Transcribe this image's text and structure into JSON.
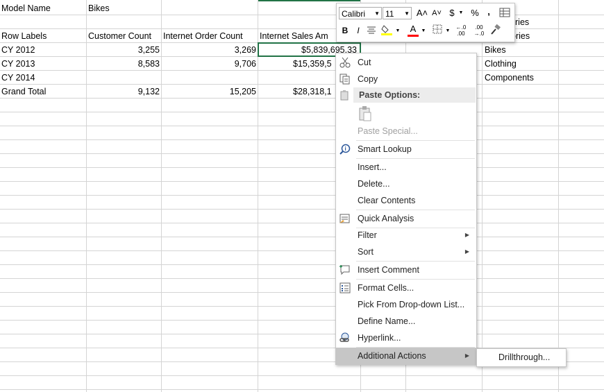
{
  "sheet": {
    "filter_label": "Model Name",
    "filter_value": "Bikes",
    "headers": [
      "Row Labels",
      "Customer Count",
      "Internet Order Count",
      "Internet Sales Am"
    ],
    "rows": [
      {
        "label": "CY 2012",
        "customer_count": "3,255",
        "order_count": "3,269",
        "sales": "$5,839,695.33"
      },
      {
        "label": "CY 2013",
        "customer_count": "8,583",
        "order_count": "9,706",
        "sales": "$15,359,5"
      },
      {
        "label": "CY 2014",
        "customer_count": "",
        "order_count": "",
        "sales": ""
      },
      {
        "label": "Grand Total",
        "customer_count": "9,132",
        "order_count": "15,205",
        "sales": "$28,318,1"
      }
    ],
    "side_header_1": "ries",
    "side_header_2": "ories",
    "side_items": [
      "Bikes",
      "Clothing",
      "Components"
    ]
  },
  "mini_toolbar": {
    "font_name": "Calibri",
    "font_size": "11",
    "grow_font": "A˄",
    "shrink_font": "A˅",
    "currency": "$",
    "percent": "%",
    "comma": ",",
    "bold": "B",
    "italic": "I",
    "font_color_letter": "A",
    "increase_decimal": "←.0 .00",
    "decrease_decimal": ".00 →.0",
    "fill_color": "#ffff00",
    "font_color": "#ff0000"
  },
  "context_menu": {
    "cut": "Cut",
    "copy": "Copy",
    "paste_options": "Paste Options:",
    "paste_special": "Paste Special...",
    "smart_lookup": "Smart Lookup",
    "insert": "Insert...",
    "delete": "Delete...",
    "clear_contents": "Clear Contents",
    "quick_analysis": "Quick Analysis",
    "filter": "Filter",
    "sort": "Sort",
    "insert_comment": "Insert Comment",
    "format_cells": "Format Cells...",
    "pick_from_list": "Pick From Drop-down List...",
    "define_name": "Define Name...",
    "hyperlink": "Hyperlink...",
    "additional_actions": "Additional Actions"
  },
  "submenu": {
    "drillthrough": "Drillthrough..."
  },
  "colors": {
    "selection_green": "#217346",
    "gridline": "#d4d4d4",
    "menu_hover": "#c6c6c6"
  }
}
